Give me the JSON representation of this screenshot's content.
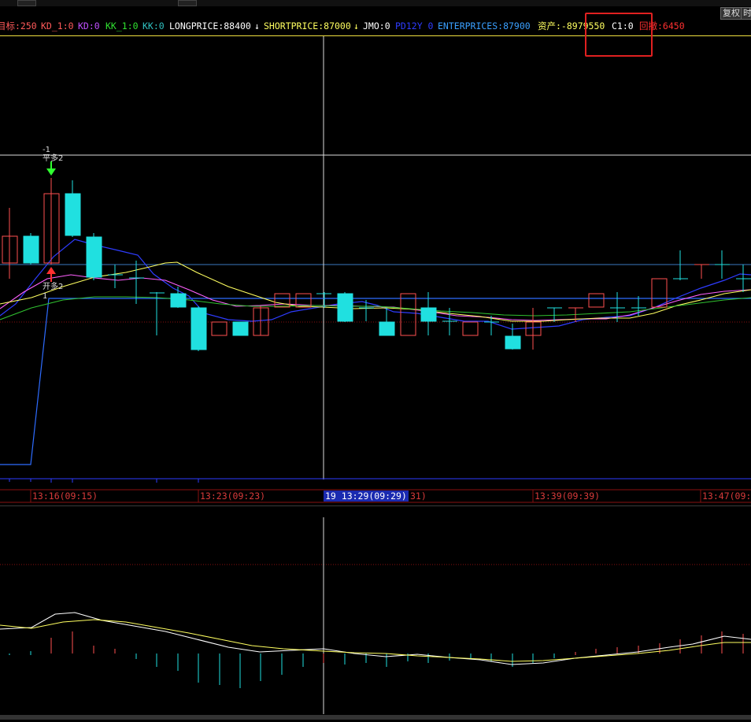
{
  "toolbar": {
    "btn_fuquan": "复权",
    "btn_time": "时"
  },
  "indicators": [
    {
      "text": "目标:250",
      "color": "#ff5a5a"
    },
    {
      "text": "KD_1:0",
      "color": "#ff5a5a"
    },
    {
      "text": "KD:0",
      "color": "#c050ff"
    },
    {
      "text": "KK_1:0",
      "color": "#30e030"
    },
    {
      "text": "KK:0",
      "color": "#30c0c0"
    },
    {
      "text": "LONGPRICE:88400",
      "color": "#ffffff"
    },
    {
      "text": "↓",
      "color": "#ffffff"
    },
    {
      "text": "SHORTPRICE:87000",
      "color": "#ffff60"
    },
    {
      "text": "↓",
      "color": "#ffff60"
    },
    {
      "text": "JMO:0",
      "color": "#ffffff"
    },
    {
      "text": "PD12Y 0",
      "color": "#2e3cff"
    },
    {
      "text": "ENTERPRICES:87900",
      "color": "#3aa0ff"
    },
    {
      "text": "资产:-8979550",
      "color": "#ffff60"
    },
    {
      "text": "C1:0",
      "color": "#ffffff"
    },
    {
      "text": "回撤:6450",
      "color": "#ff3030"
    }
  ],
  "signals": {
    "short_num": "-1",
    "short_label": "平多2",
    "long_label": "开多2",
    "long_num": "1"
  },
  "time_axis": [
    {
      "label": "13:16(09:15)",
      "current": false
    },
    {
      "label": "13:23(09:23)",
      "current": false
    },
    {
      "label": "19 13:29(09:29)",
      "current": true
    },
    {
      "label": "31)",
      "current": false
    },
    {
      "label": "13:39(09:39)",
      "current": false
    },
    {
      "label": "13:47(09:",
      "current": false
    }
  ]
}
